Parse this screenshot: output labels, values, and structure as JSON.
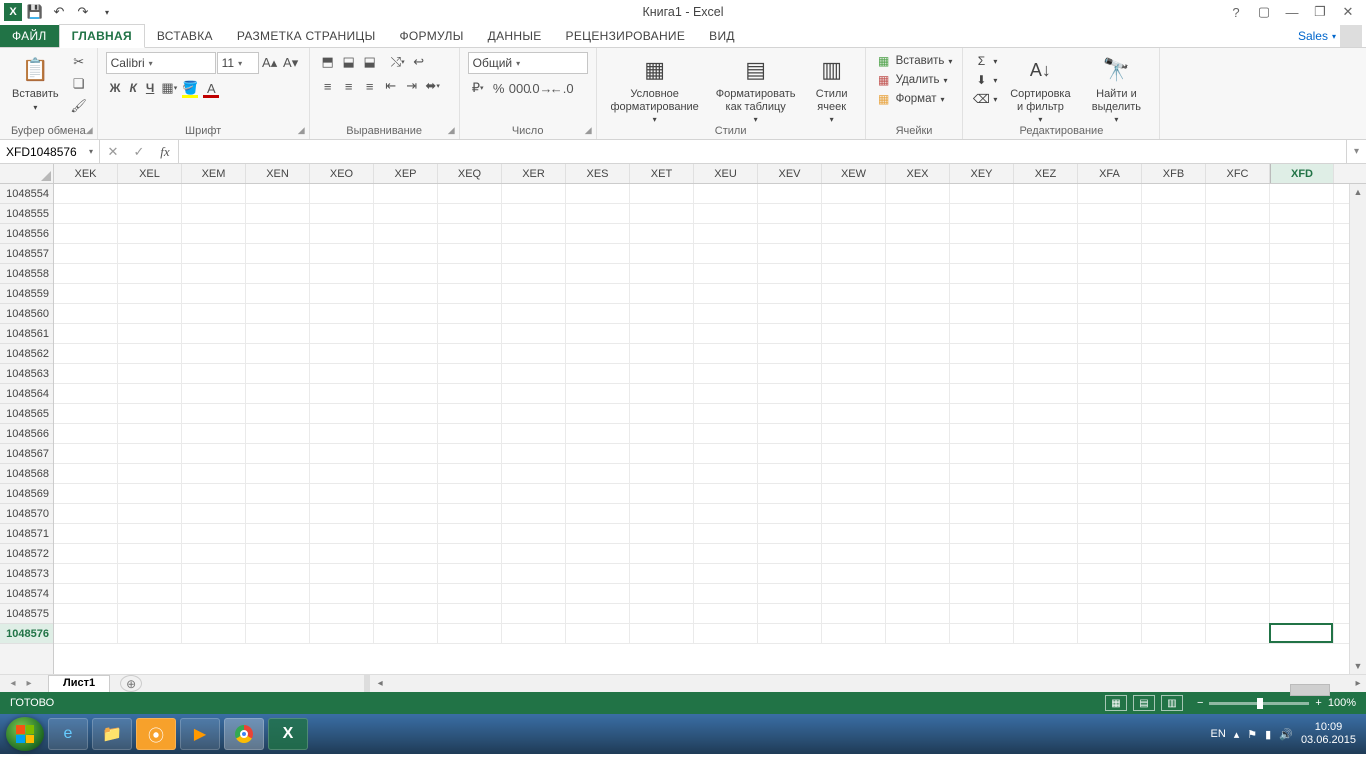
{
  "title": "Книга1 - Excel",
  "qat": {
    "undo": "↶",
    "redo": "↷"
  },
  "user": {
    "name": "Sales"
  },
  "tabs": {
    "file": "ФАЙЛ",
    "items": [
      "ГЛАВНАЯ",
      "ВСТАВКА",
      "РАЗМЕТКА СТРАНИЦЫ",
      "ФОРМУЛЫ",
      "ДАННЫЕ",
      "РЕЦЕНЗИРОВАНИЕ",
      "ВИД"
    ],
    "active": 0
  },
  "ribbon": {
    "clipboard": {
      "paste": "Вставить",
      "label": "Буфер обмена"
    },
    "font": {
      "name": "Calibri",
      "size": "11",
      "bold": "Ж",
      "italic": "К",
      "underline": "Ч",
      "label": "Шрифт"
    },
    "alignment": {
      "label": "Выравнивание"
    },
    "number": {
      "format": "Общий",
      "label": "Число"
    },
    "styles": {
      "cond": "Условное форматирование",
      "table": "Форматировать как таблицу",
      "cell": "Стили ячеек",
      "label": "Стили"
    },
    "cells": {
      "insert": "Вставить",
      "delete": "Удалить",
      "format": "Формат",
      "label": "Ячейки"
    },
    "editing": {
      "sort": "Сортировка и фильтр",
      "find": "Найти и выделить",
      "label": "Редактирование"
    }
  },
  "name_box": "XFD1048576",
  "formula": "",
  "columns": [
    "XEK",
    "XEL",
    "XEM",
    "XEN",
    "XEO",
    "XEP",
    "XEQ",
    "XER",
    "XES",
    "XET",
    "XEU",
    "XEV",
    "XEW",
    "XEX",
    "XEY",
    "XEZ",
    "XFA",
    "XFB",
    "XFC",
    "XFD"
  ],
  "selected_col": "XFD",
  "rows": [
    1048554,
    1048555,
    1048556,
    1048557,
    1048558,
    1048559,
    1048560,
    1048561,
    1048562,
    1048563,
    1048564,
    1048565,
    1048566,
    1048567,
    1048568,
    1048569,
    1048570,
    1048571,
    1048572,
    1048573,
    1048574,
    1048575,
    1048576
  ],
  "selected_row": 1048576,
  "sheet": {
    "name": "Лист1"
  },
  "status": {
    "ready": "ГОТОВО",
    "zoom": "100%"
  },
  "taskbar": {
    "lang": "EN",
    "time": "10:09",
    "date": "03.06.2015"
  }
}
